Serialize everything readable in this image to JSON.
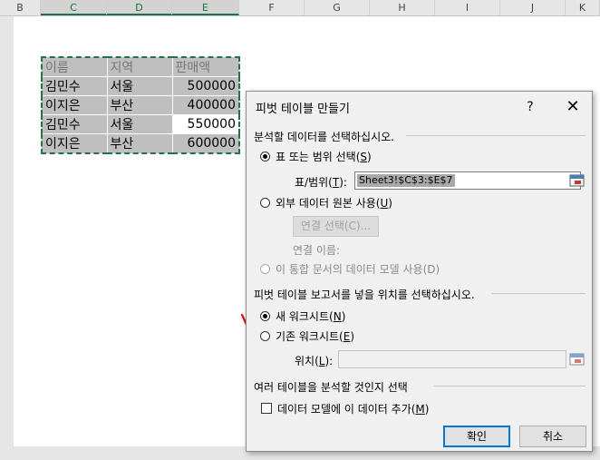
{
  "columns": [
    "B",
    "C",
    "D",
    "E",
    "F",
    "G",
    "H",
    "I",
    "J",
    "K"
  ],
  "table": {
    "header": [
      "이름",
      "지역",
      "판매액"
    ],
    "rows": [
      [
        "김민수",
        "서울",
        "500000"
      ],
      [
        "이지은",
        "부산",
        "400000"
      ],
      [
        "김민수",
        "서울",
        "550000"
      ],
      [
        "이지은",
        "부산",
        "600000"
      ]
    ]
  },
  "dialog": {
    "title": "피벗 테이블 만들기",
    "help": "?",
    "close": "✕",
    "section1": "분석할 데이터를 선택하십시오.",
    "opt_range": "표 또는 범위 선택(",
    "opt_range_key": "S",
    "range_label": "표/범위(",
    "range_key": "T",
    "range_value": "Sheet3!$C$3:$E$7",
    "opt_external": "외부 데이터 원본 사용(",
    "opt_external_key": "U",
    "choose_connection": "연결 선택(C)...",
    "connection_name": "연결 이름:",
    "opt_model": "이 통합 문서의 데이터 모델 사용(D)",
    "section2": "피벗 테이블 보고서를 넣을 위치를 선택하십시오.",
    "opt_new": "새 워크시트(",
    "opt_new_key": "N",
    "opt_existing": "기존 워크시트(",
    "opt_existing_key": "E",
    "location_label": "위치(",
    "location_key": "L",
    "location_value": "",
    "section3": "여러 테이블을 분석할 것인지 선택",
    "add_model": "데이터 모델에 이 데이터 추가(",
    "add_model_key": "M",
    "ok": "확인",
    "cancel": "취소"
  },
  "icons": {
    "range_picker": "range-select-icon",
    "annotation": "red-check-mark"
  },
  "colors": {
    "selection_border": "#217346",
    "annotation": "#e0001b",
    "primary_border": "#0078d7"
  }
}
